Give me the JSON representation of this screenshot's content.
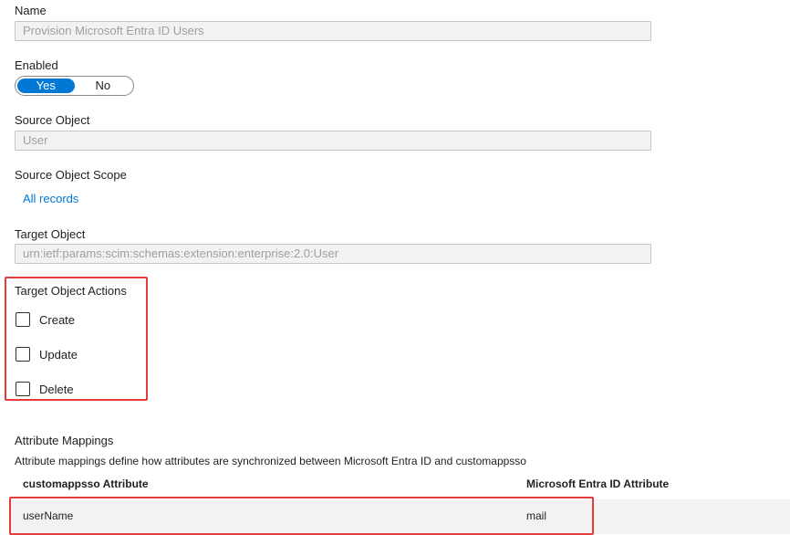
{
  "name": {
    "label": "Name",
    "value": "Provision Microsoft Entra ID Users"
  },
  "enabled": {
    "label": "Enabled",
    "options": [
      "Yes",
      "No"
    ],
    "selected": "Yes"
  },
  "source_object": {
    "label": "Source Object",
    "value": "User"
  },
  "source_object_scope": {
    "label": "Source Object Scope",
    "link": "All records"
  },
  "target_object": {
    "label": "Target Object",
    "value": "urn:ietf:params:scim:schemas:extension:enterprise:2.0:User"
  },
  "target_object_actions": {
    "label": "Target Object Actions",
    "items": [
      {
        "label": "Create",
        "checked": false
      },
      {
        "label": "Update",
        "checked": false
      },
      {
        "label": "Delete",
        "checked": false
      }
    ]
  },
  "attribute_mappings": {
    "title": "Attribute Mappings",
    "description": "Attribute mappings define how attributes are synchronized between Microsoft Entra ID and customappsso",
    "columns": [
      "customappsso Attribute",
      "Microsoft Entra ID Attribute"
    ],
    "rows": [
      [
        "userName",
        "mail"
      ]
    ]
  },
  "colors": {
    "accent": "#0078d4",
    "highlight": "#e23c3c",
    "field_bg": "#f3f2f1"
  }
}
